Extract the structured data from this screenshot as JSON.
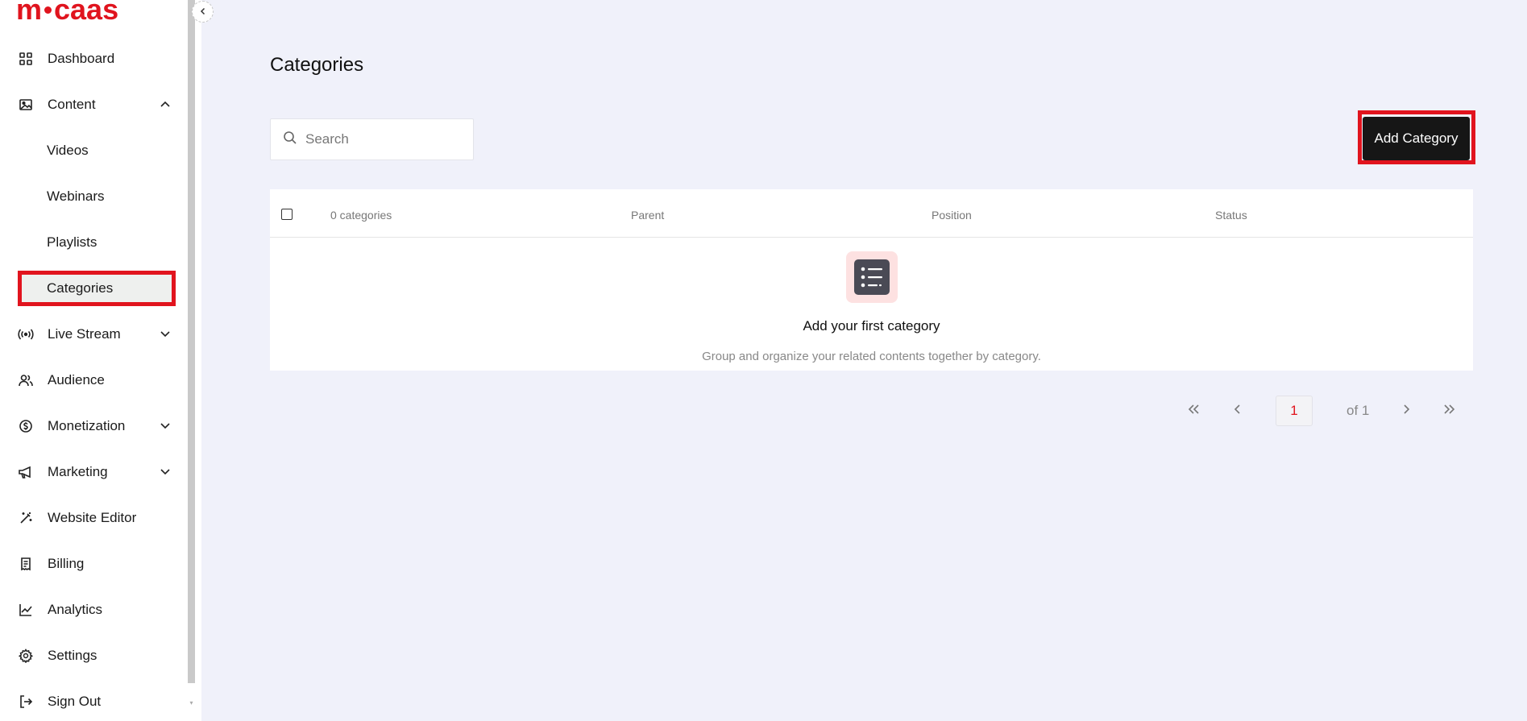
{
  "brand": {
    "logo_left": "m",
    "logo_right": "caas",
    "color": "#e0141e"
  },
  "sidebar": {
    "items": [
      {
        "label": "Dashboard",
        "icon": "grid-icon"
      },
      {
        "label": "Content",
        "icon": "image-icon",
        "expanded": true
      },
      {
        "label": "Live Stream",
        "icon": "broadcast-icon",
        "expanded": false
      },
      {
        "label": "Audience",
        "icon": "users-icon"
      },
      {
        "label": "Monetization",
        "icon": "dollar-circle-icon",
        "expanded": false
      },
      {
        "label": "Marketing",
        "icon": "megaphone-icon",
        "expanded": false
      },
      {
        "label": "Website Editor",
        "icon": "magic-wand-icon"
      },
      {
        "label": "Billing",
        "icon": "receipt-icon"
      },
      {
        "label": "Analytics",
        "icon": "line-chart-icon"
      },
      {
        "label": "Settings",
        "icon": "gear-icon"
      },
      {
        "label": "Sign Out",
        "icon": "sign-out-icon"
      }
    ],
    "content_sub": [
      "Videos",
      "Webinars",
      "Playlists",
      "Categories"
    ],
    "active_sub": "Categories"
  },
  "main": {
    "title": "Categories",
    "search": {
      "placeholder": "Search",
      "value": ""
    },
    "add_button": "Add Category",
    "table": {
      "columns": [
        "0 categories",
        "Parent",
        "Position",
        "Status"
      ],
      "empty_title": "Add your first category",
      "empty_desc": "Group and organize your related contents together by category."
    },
    "pagination": {
      "current": "1",
      "of_label": "of 1"
    }
  },
  "colors": {
    "accent": "#e1141e",
    "button_dark": "#161616",
    "background": "#f0f1fa"
  }
}
